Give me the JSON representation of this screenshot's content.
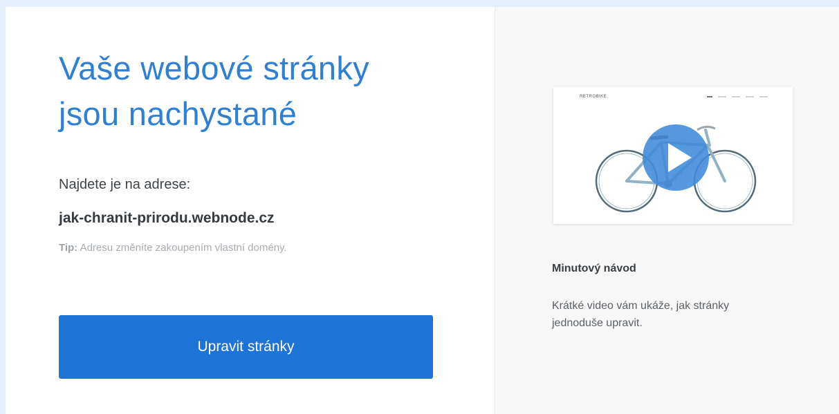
{
  "main": {
    "title_line1": "Vaše webové stránky",
    "title_line2": "jsou nachystané",
    "find_label": "Najdete je na adrese:",
    "address": "jak-chranit-prirodu.webnode.cz",
    "tip_label": "Tip:",
    "tip_text": "Adresu změníte zakoupením vlastní domény.",
    "edit_button_label": "Upravit stránky"
  },
  "side": {
    "thumbnail_logo": "RETROBIKE",
    "video_title": "Minutový návod",
    "video_description": "Krátké video vám ukáže, jak stránky jednoduše upravit."
  },
  "colors": {
    "accent": "#1e74d6",
    "title": "#2f7fd3",
    "play": "#3f8ad9",
    "background": "#e4eef8"
  },
  "icons": {
    "play": "play-icon"
  }
}
